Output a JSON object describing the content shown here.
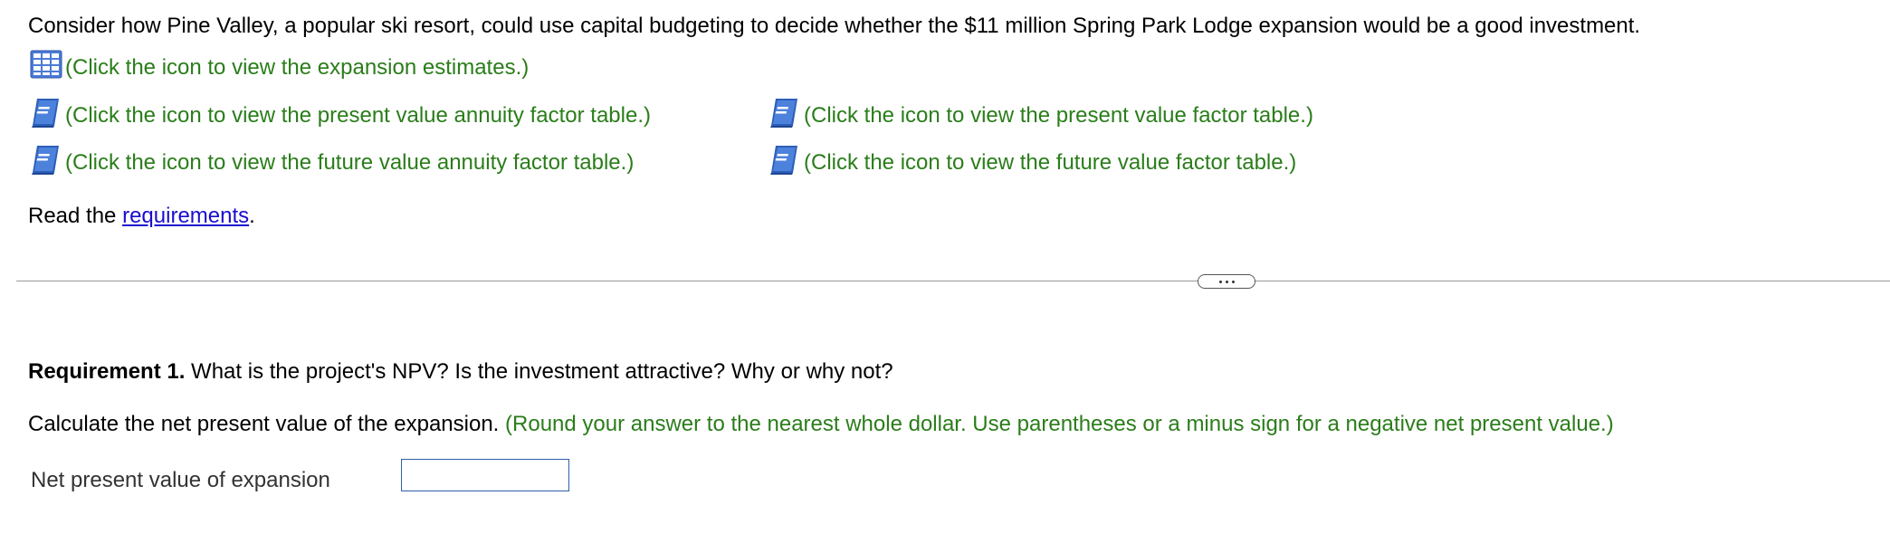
{
  "question": {
    "intro": "Consider how Pine Valley, a popular ski resort, could use capital budgeting to decide whether the $11 million Spring Park Lodge expansion would be a good investment.",
    "links": {
      "expansion_estimates": {
        "icon": "table-grid-icon",
        "text": "(Click the icon to view the expansion estimates.)"
      },
      "pv_annuity_table": {
        "icon": "book-icon",
        "text": "(Click the icon to view the present value annuity factor table.)"
      },
      "pv_table": {
        "icon": "book-icon",
        "text": "(Click the icon to view the present value factor table.)"
      },
      "fv_annuity_table": {
        "icon": "book-icon",
        "text": "(Click the icon to view the future value annuity factor table.)"
      },
      "fv_table": {
        "icon": "book-icon",
        "text": "(Click the icon to view the future value factor table.)"
      }
    },
    "read_prefix": "Read the ",
    "read_link": "requirements",
    "read_suffix": "."
  },
  "requirement1": {
    "label": "Requirement 1.",
    "text": " What is the project's NPV? Is the investment attractive? Why or why not?",
    "calc_text": "Calculate the net present value of the expansion. ",
    "calc_hint": "(Round your answer to the nearest whole dollar. Use parentheses or a minus sign for a negative net present value.)",
    "npv_label": "Net present value of expansion",
    "npv_value": ""
  },
  "colors": {
    "instruction_green": "#2a7d1a",
    "link_blue": "#1a0dce",
    "icon_blue": "#3d6fc9",
    "input_border": "#2f5fa8"
  }
}
